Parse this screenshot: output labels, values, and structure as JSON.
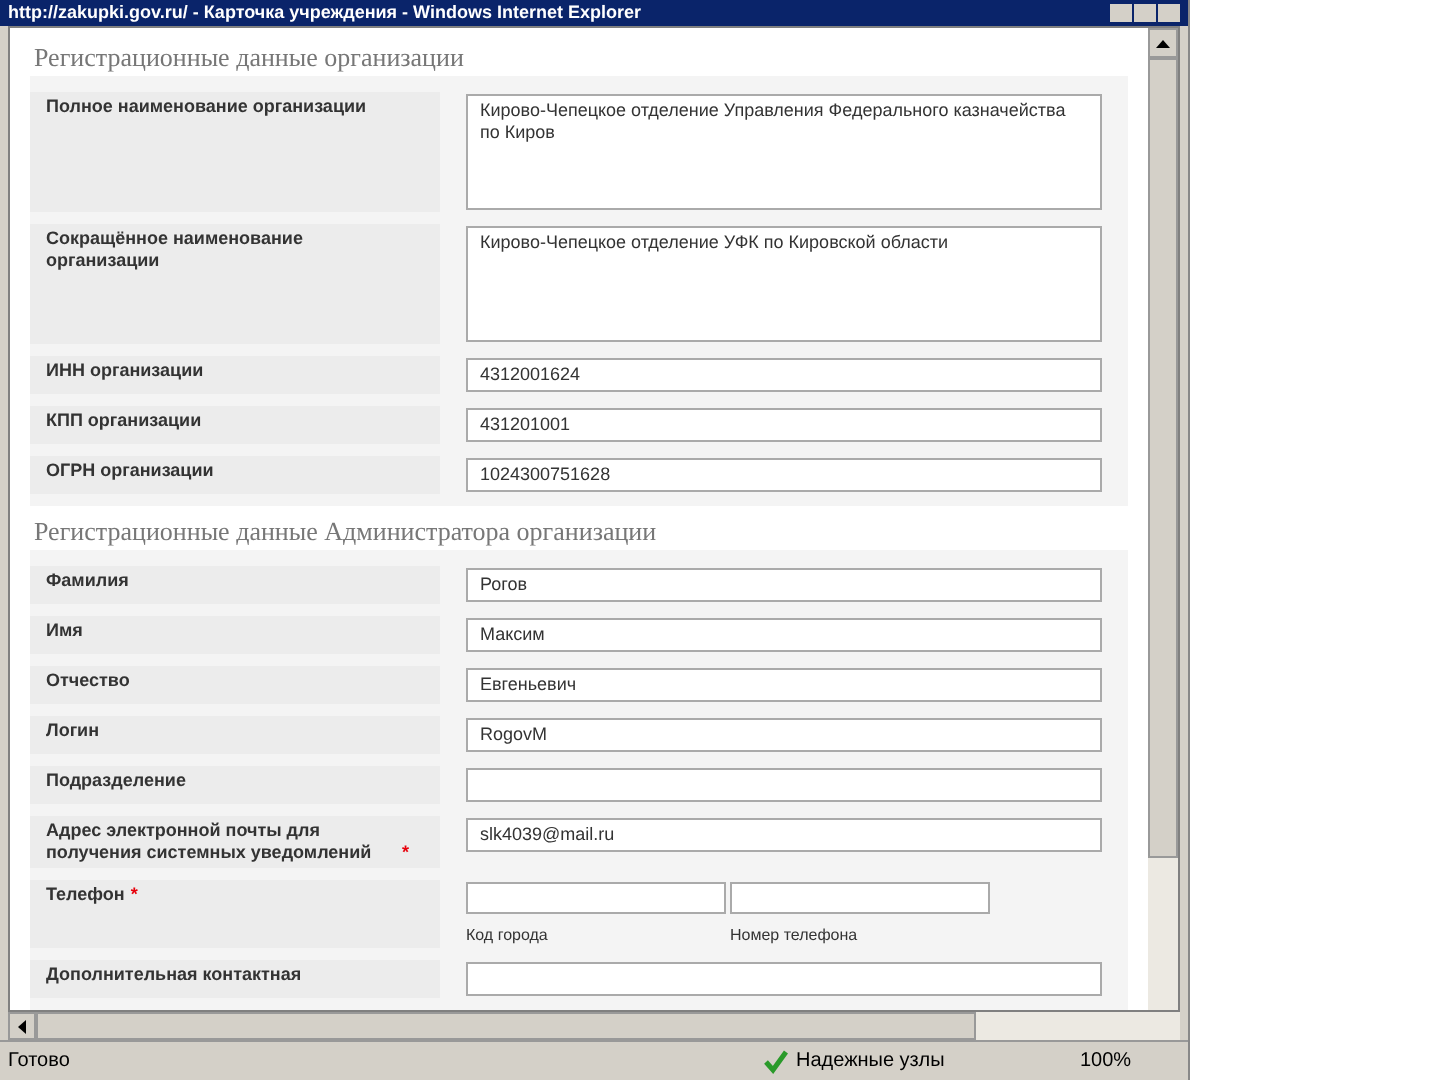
{
  "window": {
    "title": "http://zakupki.gov.ru/ - Карточка учреждения - Windows Internet Explorer"
  },
  "sections": [
    {
      "title": "Регистрационные данные организации",
      "fields": [
        {
          "kind": "textarea",
          "label": "Полное наименование организации",
          "value": "Кирово-Чепецкое отделение Управления Федерального казначейства по Киров"
        },
        {
          "kind": "textarea",
          "label": "Сокращённое наименование организации",
          "value": "Кирово-Чепецкое отделение УФК по Кировской области"
        },
        {
          "kind": "text",
          "label": "ИНН организации",
          "value": "4312001624"
        },
        {
          "kind": "text",
          "label": "КПП организации",
          "value": "431201001"
        },
        {
          "kind": "text",
          "label": "ОГРН организации",
          "value": "1024300751628"
        }
      ]
    },
    {
      "title": "Регистрационные данные Администратора организации",
      "fields": [
        {
          "kind": "text",
          "label": "Фамилия",
          "value": "Рогов"
        },
        {
          "kind": "text",
          "label": "Имя",
          "value": "Максим"
        },
        {
          "kind": "text",
          "label": "Отчество",
          "value": "Евгеньевич"
        },
        {
          "kind": "text",
          "label": "Логин",
          "value": "RogovM"
        },
        {
          "kind": "text",
          "label": "Подразделение"
        },
        {
          "kind": "text",
          "label": "Адрес электронной почты для получения системных уведомлений",
          "required_mark": "*",
          "value": "slk4039@mail.ru"
        },
        {
          "kind": "phone",
          "label": "Телефон",
          "required_mark": "*",
          "captions": [
            "Код города",
            "Номер телефона"
          ]
        },
        {
          "kind": "text",
          "label": "Дополнительная контактная"
        }
      ]
    }
  ],
  "status_bar": {
    "status": "Готово",
    "zone": "Надежные узлы",
    "zoom": "100%"
  }
}
